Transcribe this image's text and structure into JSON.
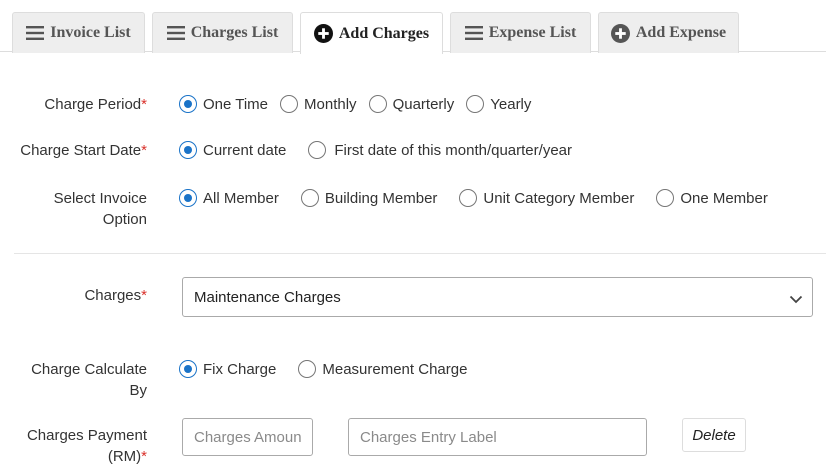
{
  "tabs": [
    {
      "label": "Invoice List",
      "icon": "list-icon",
      "active": false
    },
    {
      "label": "Charges List",
      "icon": "list-icon",
      "active": false
    },
    {
      "label": "Add Charges",
      "icon": "plus-circle-icon",
      "active": true
    },
    {
      "label": "Expense List",
      "icon": "list-icon",
      "active": false
    },
    {
      "label": "Add Expense",
      "icon": "plus-circle-icon",
      "active": false
    }
  ],
  "form": {
    "charge_period": {
      "label": "Charge Period",
      "required": "*",
      "options": [
        "One Time",
        "Monthly",
        "Quarterly",
        "Yearly"
      ],
      "selected": "One Time"
    },
    "charge_start_date": {
      "label": "Charge Start Date",
      "required": "*",
      "options": [
        "Current date",
        "First date of this month/quarter/year"
      ],
      "selected": "Current date"
    },
    "invoice_option": {
      "label_line1": "Select Invoice",
      "label_line2": "Option",
      "options": [
        "All Member",
        "Building Member",
        "Unit Category Member",
        "One Member"
      ],
      "selected": "All Member"
    },
    "charges": {
      "label": "Charges",
      "required": "*",
      "value": "Maintenance Charges"
    },
    "calculate_by": {
      "label_line1": "Charge Calculate",
      "label_line2": "By",
      "options": [
        "Fix Charge",
        "Measurement Charge"
      ],
      "selected": "Fix Charge"
    },
    "payment": {
      "label_line1": "Charges Payment",
      "label_line2": "(RM)",
      "required": "*",
      "amount_placeholder": "Charges Amount",
      "entry_label_placeholder": "Charges Entry Label",
      "delete_label": "Delete"
    }
  },
  "colors": {
    "accent": "#1a73c8",
    "required": "#d9312b",
    "tab_bg": "#eeeeee",
    "border": "#dddddd"
  }
}
